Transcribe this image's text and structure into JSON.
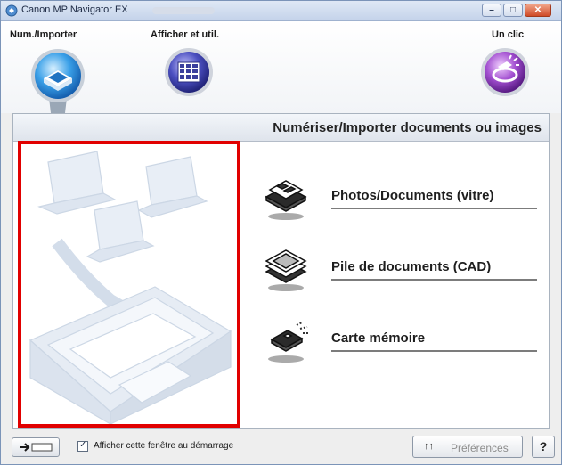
{
  "window": {
    "title": "Canon MP Navigator EX",
    "controls": [
      "minimize",
      "maximize",
      "close"
    ]
  },
  "modes": [
    {
      "label": "Num./Importer",
      "icon": "scanner-icon",
      "selected": true
    },
    {
      "label": "Afficher et util.",
      "icon": "document-grid-icon",
      "selected": false
    },
    {
      "label": "Un clic",
      "icon": "one-click-icon",
      "selected": false
    }
  ],
  "panel": {
    "header": "Numériser/Importer documents ou images",
    "illustration_icon": "scanner-computers-illustration",
    "actions": [
      {
        "label": "Photos/Documents (vitre)",
        "icon": "photo-docs-platen-icon"
      },
      {
        "label": "Pile de documents (CAD)",
        "icon": "document-stack-adf-icon"
      },
      {
        "label": "Carte mémoire",
        "icon": "memory-card-icon"
      }
    ]
  },
  "bottom": {
    "toggle_icon": "arrow-toggle-icon",
    "checkbox_checked": true,
    "checkbox_label": "Afficher cette fenêtre au démarrage",
    "preferences_label": "Préférences",
    "preferences_icon": "preferences-icon",
    "help_label": "?"
  },
  "colors": {
    "highlight_border": "#e10000",
    "accent_blue": "#2f8fd9",
    "accent_purple": "#9c44c9"
  }
}
